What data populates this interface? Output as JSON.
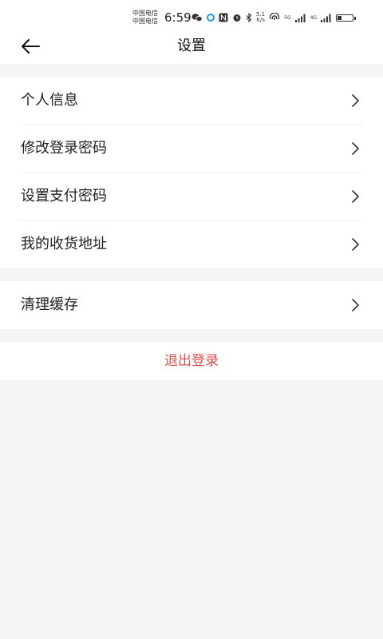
{
  "status_bar": {
    "carrier_1": "中国电信",
    "carrier_2": "中国电信",
    "time": "6:59",
    "speed_value": "5.1",
    "speed_unit": "K/s",
    "sim1_network": "5G",
    "sim2_network": "4G",
    "battery_level": 0.3
  },
  "header": {
    "title": "设置",
    "back_icon": "arrow-left-icon"
  },
  "menu_group_1": [
    {
      "label": "个人信息",
      "icon": "chevron-right-icon"
    },
    {
      "label": "修改登录密码",
      "icon": "chevron-right-icon"
    },
    {
      "label": "设置支付密码",
      "icon": "chevron-right-icon"
    },
    {
      "label": "我的收货地址",
      "icon": "chevron-right-icon"
    }
  ],
  "menu_group_2": [
    {
      "label": "清理缓存",
      "icon": "chevron-right-icon"
    }
  ],
  "logout": {
    "label": "退出登录",
    "color": "#e34c48"
  }
}
